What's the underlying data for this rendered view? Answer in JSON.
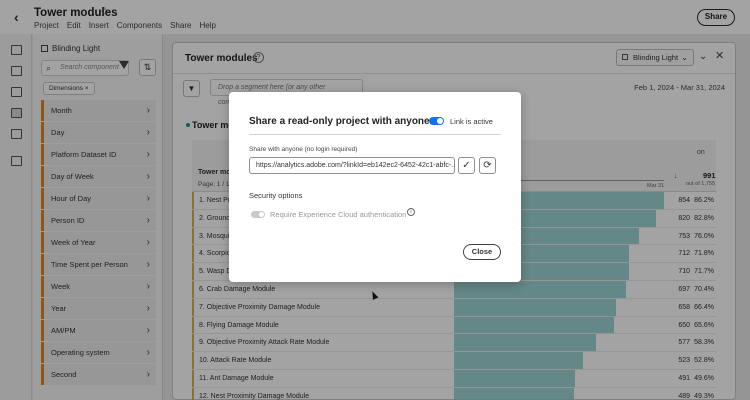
{
  "app": {
    "title": "Tower modules",
    "menu": [
      "Project",
      "Edit",
      "Insert",
      "Components",
      "Share",
      "Help"
    ],
    "share_label": "Share"
  },
  "panel": {
    "dataset": "Blinding Light",
    "search_placeholder": "Search component",
    "chip": "Dimensions",
    "dimensions": [
      "Month",
      "Day",
      "Platform Dataset ID",
      "Day of Week",
      "Hour of Day",
      "Person ID",
      "Week of Year",
      "Time Spent per Person",
      "Week",
      "Year",
      "AM/PM",
      "Operating system",
      "Second"
    ]
  },
  "workspace": {
    "title": "Tower modules",
    "report_suite": "Blinding Light",
    "dropzone": "Drop a segment here (or any other component)",
    "daterange": "Feb 1, 2024 - Mar 31, 2024",
    "table_title": "Tower modules",
    "table_header": "Tower mo",
    "page": "Page: 1 / 1",
    "metric_header": "on",
    "axis_end": "Mar 31",
    "total": "991",
    "total_sub": "out of 1,755"
  },
  "table_rows": [
    {
      "label": "1.  Nest Pro",
      "value": "854",
      "pct": "86.2%",
      "share": 0.862
    },
    {
      "label": "2.  Ground",
      "value": "820",
      "pct": "82.8%",
      "share": 0.828
    },
    {
      "label": "3.  Mosqui",
      "value": "753",
      "pct": "76.0%",
      "share": 0.76
    },
    {
      "label": "4.  Scorpio",
      "value": "712",
      "pct": "71.8%",
      "share": 0.718
    },
    {
      "label": "5.  Wasp D",
      "value": "710",
      "pct": "71.7%",
      "share": 0.717
    },
    {
      "label": "6.  Crab Damage Module",
      "value": "697",
      "pct": "70.4%",
      "share": 0.704
    },
    {
      "label": "7.  Objective Proximity Damage Module",
      "value": "658",
      "pct": "66.4%",
      "share": 0.664
    },
    {
      "label": "8.  Flying Damage Module",
      "value": "650",
      "pct": "65.6%",
      "share": 0.656
    },
    {
      "label": "9.  Objective Proximity Attack Rate Module",
      "value": "577",
      "pct": "58.3%",
      "share": 0.583
    },
    {
      "label": "10.  Attack Rate Module",
      "value": "523",
      "pct": "52.8%",
      "share": 0.528
    },
    {
      "label": "11.  Ant Damage Module",
      "value": "491",
      "pct": "49.6%",
      "share": 0.496
    },
    {
      "label": "12.  Nest Proximity Damage Module",
      "value": "489",
      "pct": "49.3%",
      "share": 0.493
    }
  ],
  "modal": {
    "title": "Share a read-only project with anyone",
    "link_active_label": "Link is active",
    "share_sub": "Share with anyone (no login required)",
    "url": "https://analytics.adobe.com/?linkId=eb142ec2-6452-42c1-abfc-...",
    "security_heading": "Security options",
    "auth_label": "Require Experience Cloud authentication",
    "close_label": "Close"
  },
  "colors": {
    "accent": "#1473e6",
    "bar": "#8ccccd",
    "dimension_marker": "#e68619"
  }
}
